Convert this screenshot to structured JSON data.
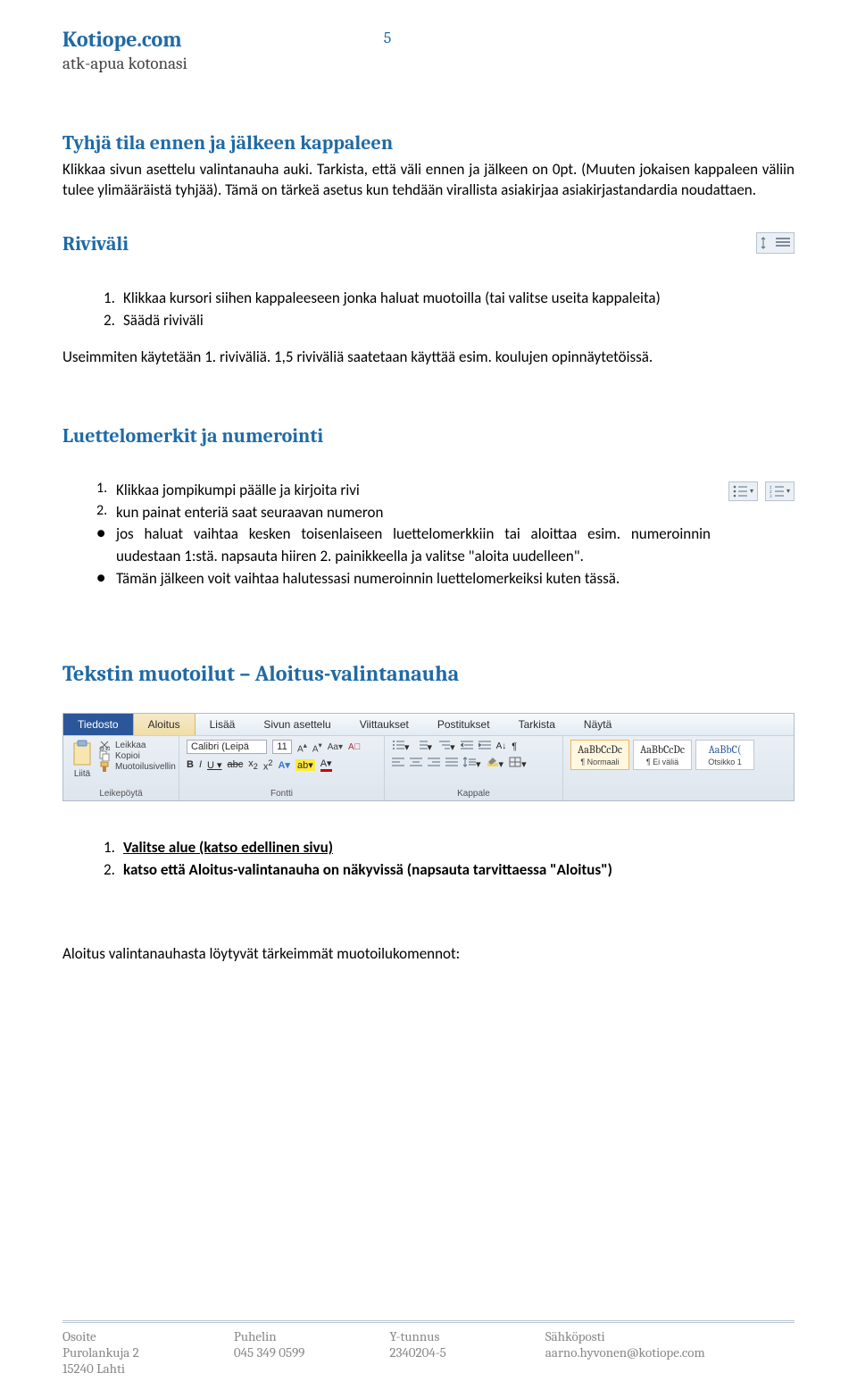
{
  "header": {
    "site_title": "Kotiope.com",
    "site_sub": "atk-apua kotonasi",
    "page_number": "5"
  },
  "sections": {
    "tyhja": {
      "heading": "Tyhjä tila ennen ja jälkeen kappaleen",
      "body": "Klikkaa sivun asettelu valintanauha auki. Tarkista, että väli ennen ja jälkeen on 0pt. (Muuten jokaisen kappaleen väliin tulee ylimääräistä tyhjää). Tämä on tärkeä asetus kun tehdään virallista asiakirjaa asiakirjastandardia noudattaen."
    },
    "rivivali": {
      "heading": "Riviväli",
      "items": [
        "Klikkaa kursori siihen kappaleeseen jonka haluat muotoilla (tai valitse useita kappaleita)",
        "Säädä riviväli"
      ],
      "after": "Useimmiten käytetään 1. riviväliä.  1,5 riviväliä saatetaan käyttää esim. koulujen opinnäytetöissä."
    },
    "luettelo": {
      "heading": "Luettelomerkit ja numerointi",
      "items": [
        "Klikkaa jompikumpi päälle ja kirjoita rivi",
        "kun painat enteriä saat seuraavan numeron",
        "jos haluat vaihtaa kesken toisenlaiseen luettelomerkkiin tai aloittaa esim. numeroinnin uudestaan 1:stä. napsauta hiiren 2. painikkeella ja valitse \"aloita uudelleen\".",
        "Tämän jälkeen voit vaihtaa halutessasi numeroinnin luettelomerkeiksi kuten tässä."
      ]
    },
    "tekstin": {
      "heading": "Tekstin muotoilut – Aloitus-valintanauha",
      "items": [
        "Valitse alue (katso edellinen sivu)",
        "katso että Aloitus-valintanauha on näkyvissä (napsauta tarvittaessa \"Aloitus\")"
      ],
      "after": "Aloitus valintanauhasta löytyvät tärkeimmät muotoilukomennot:"
    }
  },
  "ribbon": {
    "tabs": [
      "Tiedosto",
      "Aloitus",
      "Lisää",
      "Sivun asettelu",
      "Viittaukset",
      "Postitukset",
      "Tarkista",
      "Näytä"
    ],
    "clipboard": {
      "paste": "Liitä",
      "cut": "Leikkaa",
      "copy": "Kopioi",
      "fmt": "Muotoilusivellin",
      "label": "Leikepöytä"
    },
    "font": {
      "name": "Calibri (Leipä",
      "size": "11",
      "label": "Fontti"
    },
    "paragraph": {
      "label": "Kappale"
    },
    "styles": {
      "s1": "AaBbCcDc",
      "s1n": "¶ Normaali",
      "s2": "AaBbCcDc",
      "s2n": "¶ Ei väliä",
      "s3": "AaBbC(",
      "s3n": "Otsikko 1"
    }
  },
  "footer": {
    "cols": [
      {
        "head": "Osoite",
        "v1": "Purolankuja 2",
        "v2": "15240 Lahti"
      },
      {
        "head": "Puhelin",
        "v1": "045 349 0599",
        "v2": ""
      },
      {
        "head": "Y-tunnus",
        "v1": "2340204-5",
        "v2": ""
      },
      {
        "head": "Sähköposti",
        "v1": "aarno.hyvonen@kotiope.com",
        "v2": ""
      }
    ]
  }
}
